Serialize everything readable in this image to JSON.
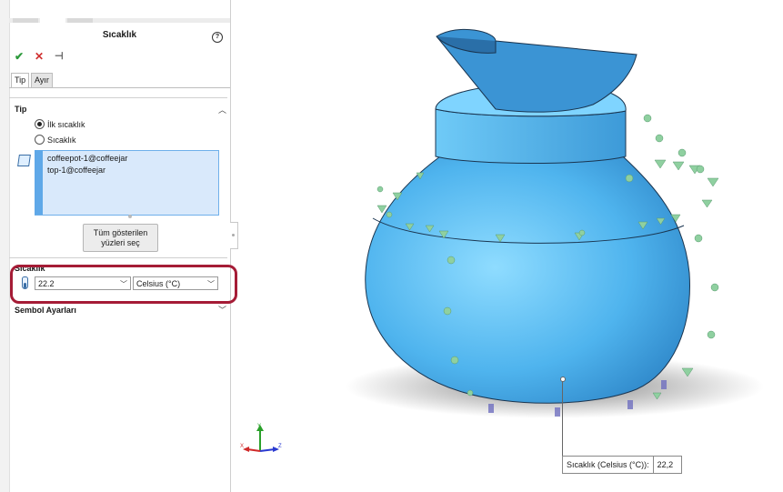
{
  "panel": {
    "title": "Sıcaklık",
    "help_icon": "help-icon",
    "ok_icon": "checkmark-icon",
    "cancel_icon": "close-icon",
    "pin_icon": "pushpin-icon",
    "tabs": [
      "Tip",
      "Ayır"
    ],
    "tip_section": {
      "header": "Tip",
      "options": [
        "İlk sıcaklık",
        "Sıcaklık"
      ],
      "selected_option": "İlk sıcaklık",
      "selected_faces": [
        "coffeepot-1@coffeejar",
        "top-1@coffeejar"
      ],
      "select_all_button": [
        "Tüm gösterilen",
        "yüzleri seç"
      ]
    },
    "temperature_section": {
      "header": "Sıcaklık",
      "value": "22.2",
      "unit": "Celsius (°C)"
    },
    "symbol_section": {
      "header": "Sembol Ayarları"
    }
  },
  "viewport": {
    "tooltip_label": "Sıcaklık (Celsius (°C)):",
    "tooltip_value": "22,2",
    "triad_axes": [
      "Y",
      "Z",
      "X"
    ]
  },
  "colors": {
    "highlight": "#a51c36",
    "model_blue": "#5ab8f0",
    "selection_fill": "#d9e9fb",
    "marker_green": "#8fd0a0"
  }
}
